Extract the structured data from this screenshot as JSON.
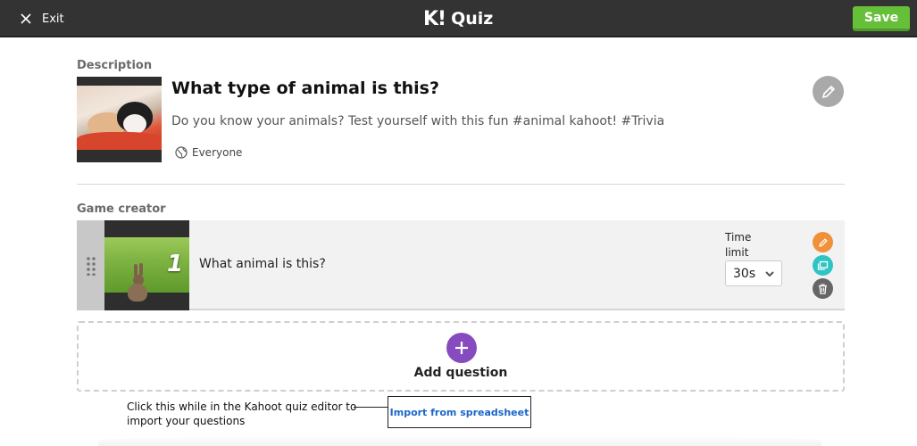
{
  "topbar": {
    "exit_label": "Exit",
    "logo": "K!",
    "title": "Quiz",
    "save_label": "Save"
  },
  "description": {
    "section_label": "Description",
    "title": "What type of animal is this?",
    "text": "Do you know your animals? Test yourself with this fun #animal kahoot! #Trivia",
    "visibility": "Everyone"
  },
  "game_creator": {
    "section_label": "Game creator",
    "questions": [
      {
        "number": "1",
        "text": "What animal is this?",
        "time_limit_label": "Time limit",
        "time_limit_value": "30s"
      }
    ],
    "add_question_label": "Add question"
  },
  "annotation": {
    "text": "Click this while in the Kahoot quiz editor to import your questions",
    "import_label": "Import from spreadsheet"
  },
  "colors": {
    "topbar": "#333333",
    "save": "#66bf39",
    "add": "#864cbf",
    "edit": "#f0913a",
    "duplicate": "#2fc4c4",
    "delete": "#666666",
    "link": "#1a66c9"
  }
}
